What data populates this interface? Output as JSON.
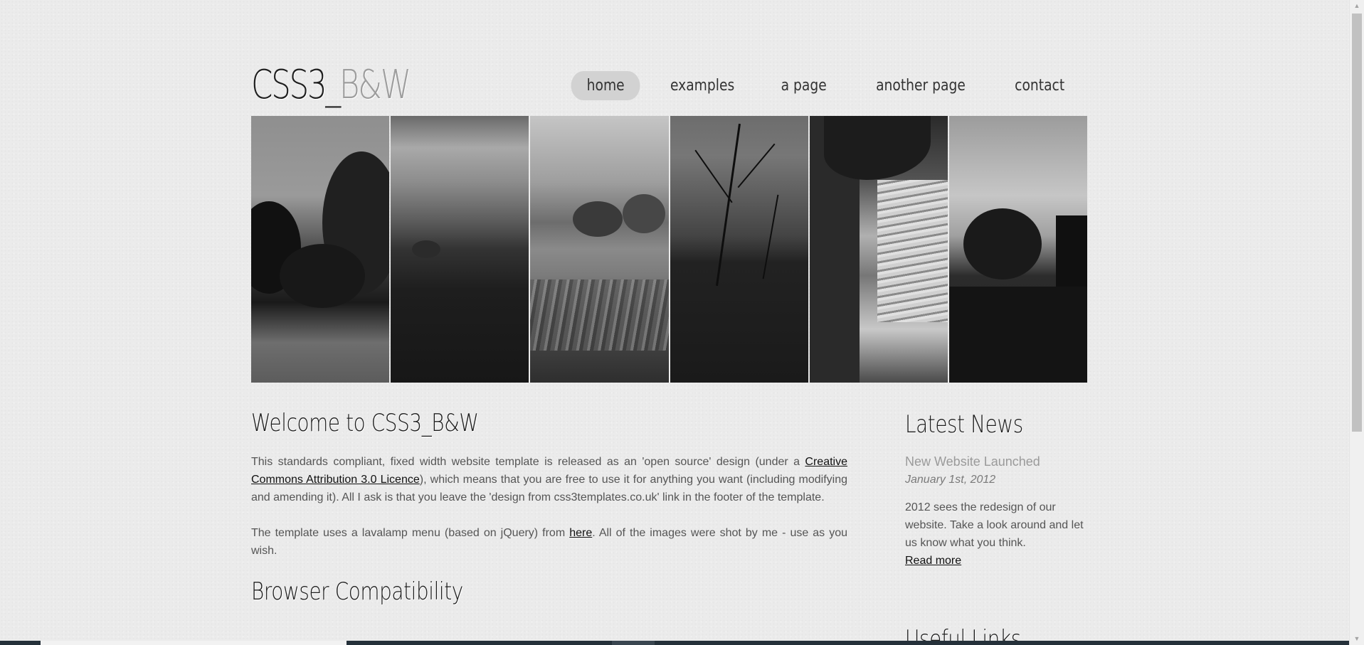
{
  "header": {
    "logo_dark": "CSS3_",
    "logo_light": "B&W"
  },
  "nav": {
    "items": [
      {
        "label": "home",
        "active": true
      },
      {
        "label": "examples",
        "active": false
      },
      {
        "label": "a page",
        "active": false
      },
      {
        "label": "another page",
        "active": false
      },
      {
        "label": "contact",
        "active": false
      }
    ]
  },
  "main": {
    "title": "Welcome to CSS3_B&W",
    "para1_part1": "This standards compliant, fixed width website template is released as an 'open source' design (under a ",
    "para1_link": "Creative Commons Attribution 3.0 Licence",
    "para1_part2": "), which means that you are free to use it for anything you want (including modifying and amending it). All I ask is that you leave the 'design from css3templates.co.uk' link in the footer of the template.",
    "para2_part1": "The template uses a lavalamp menu (based on jQuery) from ",
    "para2_link": "here",
    "para2_part2": ". All of the images were shot by me - use as you wish.",
    "subtitle": "Browser Compatibility"
  },
  "sidebar": {
    "title": "Latest News",
    "news_title": "New Website Launched",
    "news_date": "January 1st, 2012",
    "news_body": "2012 sees the redesign of our website. Take a look around and let us know what you think.",
    "read_more": "Read more",
    "useful_links_title": "Useful Links"
  },
  "colors": {
    "background": "#ebebeb",
    "nav_active_bg": "#d2d2d2",
    "logo_light": "#9d9d9d"
  }
}
